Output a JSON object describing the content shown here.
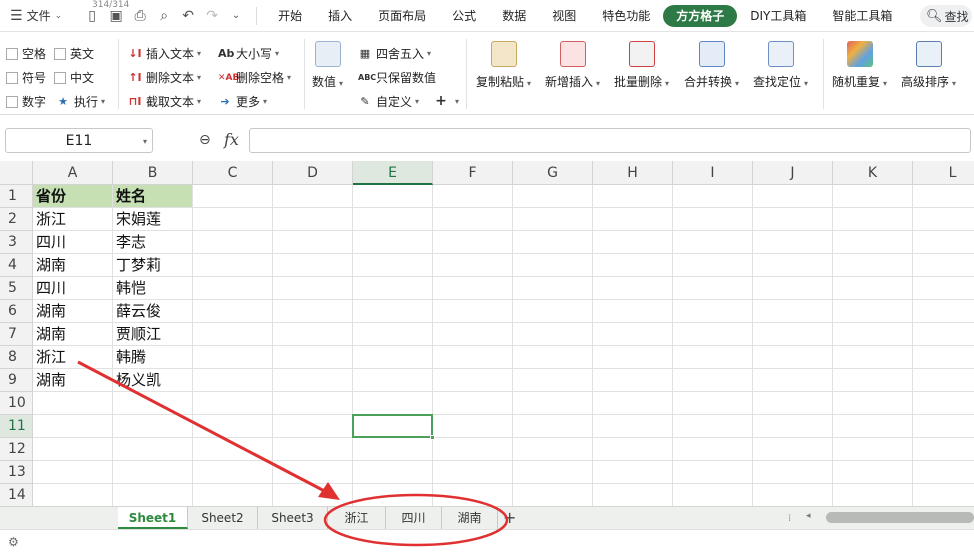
{
  "menubar": {
    "file_label": "文件",
    "counter": "314/314",
    "tabs": [
      "开始",
      "插入",
      "页面布局",
      "公式",
      "数据",
      "视图",
      "特色功能",
      "方方格子",
      "DIY工具箱",
      "智能工具箱"
    ],
    "active_tab": "方方格子",
    "search_label": "查找"
  },
  "ribbon": {
    "checks": {
      "space": "空格",
      "english": "英文",
      "symbol": "符号",
      "chinese": "中文",
      "number": "数字"
    },
    "execute": "执行",
    "insert_text": "插入文本",
    "delete_text": "删除文本",
    "extract_text": "截取文本",
    "case": "大小写",
    "delete_space": "删除空格",
    "more": "更多",
    "numeric": "数值",
    "round": "四舍五入",
    "keep_value": "只保留数值",
    "custom": "自定义",
    "copy_paste": "复制粘贴",
    "new_insert": "新增插入",
    "batch_delete": "批量删除",
    "merge_convert": "合并转换",
    "find_locate": "查找定位",
    "random_repeat": "随机重复",
    "advanced_sort": "高级排序"
  },
  "formula_bar": {
    "name_box": "E11",
    "fx": "fx",
    "formula": ""
  },
  "grid": {
    "columns": [
      "A",
      "B",
      "C",
      "D",
      "E",
      "F",
      "G",
      "H",
      "I",
      "J",
      "K",
      "L"
    ],
    "selected_column": "E",
    "rows": [
      "1",
      "2",
      "3",
      "4",
      "5",
      "6",
      "7",
      "8",
      "9",
      "10",
      "11",
      "12",
      "13",
      "14"
    ],
    "selected_row": "11",
    "header": [
      "省份",
      "姓名"
    ],
    "data": [
      [
        "浙江",
        "宋娟莲"
      ],
      [
        "四川",
        "李志"
      ],
      [
        "湖南",
        "丁梦莉"
      ],
      [
        "四川",
        "韩恺"
      ],
      [
        "湖南",
        "薛云俊"
      ],
      [
        "湖南",
        "贾顺江"
      ],
      [
        "浙江",
        "韩腾"
      ],
      [
        "湖南",
        "杨义凯"
      ]
    ]
  },
  "sheets": {
    "tabs": [
      "Sheet1",
      "Sheet2",
      "Sheet3",
      "浙江",
      "四川",
      "湖南"
    ],
    "active": "Sheet1",
    "add": "+"
  },
  "annotation": {
    "arrow_color": "#e03030",
    "ellipse_color": "#e03030"
  }
}
